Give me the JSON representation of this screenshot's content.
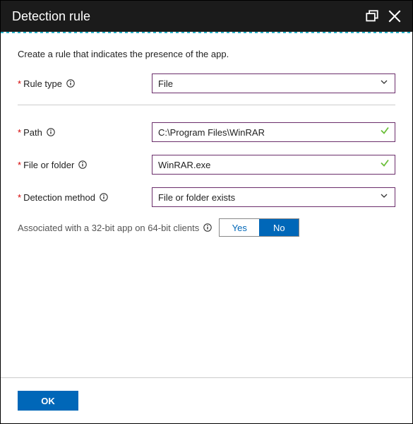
{
  "titlebar": {
    "title": "Detection rule"
  },
  "description": "Create a rule that indicates the presence of the app.",
  "fields": {
    "rule_type": {
      "label": "Rule type",
      "value": "File"
    },
    "path": {
      "label": "Path",
      "value": "C:\\Program Files\\WinRAR"
    },
    "file_or_folder": {
      "label": "File or folder",
      "value": "WinRAR.exe"
    },
    "detection_method": {
      "label": "Detection method",
      "value": "File or folder exists"
    }
  },
  "toggle": {
    "label": "Associated with a 32-bit app on 64-bit clients",
    "yes": "Yes",
    "no": "No",
    "selected": "No"
  },
  "footer": {
    "ok": "OK"
  }
}
